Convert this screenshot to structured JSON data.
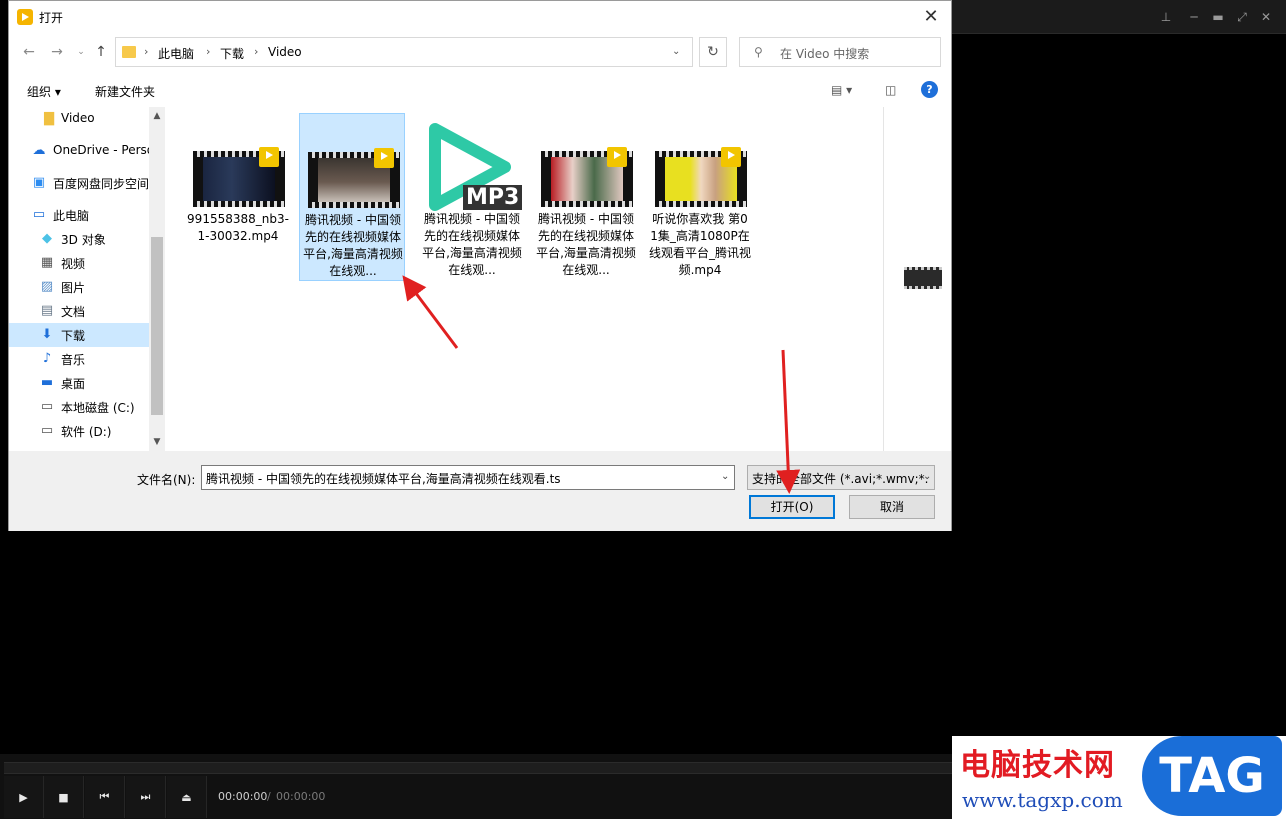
{
  "dialog": {
    "title": "打开",
    "breadcrumb": [
      "此电脑",
      "下载",
      "Video"
    ],
    "search_placeholder": "在 Video 中搜索",
    "toolbar": {
      "organize": "组织",
      "new_folder": "新建文件夹"
    },
    "nav_items": [
      {
        "label": "Video",
        "icon": "folder-icon"
      },
      {
        "label": "OneDrive - Perso",
        "icon": "cloud-icon"
      },
      {
        "label": "百度网盘同步空间",
        "icon": "baidu-icon"
      },
      {
        "label": "此电脑",
        "icon": "computer-icon"
      },
      {
        "label": "3D 对象",
        "icon": "cube-icon"
      },
      {
        "label": "视频",
        "icon": "video-icon"
      },
      {
        "label": "图片",
        "icon": "picture-icon"
      },
      {
        "label": "文档",
        "icon": "document-icon"
      },
      {
        "label": "下载",
        "icon": "download-icon",
        "selected": true
      },
      {
        "label": "音乐",
        "icon": "music-icon"
      },
      {
        "label": "桌面",
        "icon": "desktop-icon"
      },
      {
        "label": "本地磁盘 (C:)",
        "icon": "drive-icon"
      },
      {
        "label": "软件 (D:)",
        "icon": "drive-icon"
      }
    ],
    "files": [
      {
        "name": "991558388_nb3-1-30032.mp4",
        "type": "video"
      },
      {
        "name": "腾讯视频 - 中国领先的在线视频媒体平台,海量高清视频在线观...",
        "type": "video",
        "selected": true
      },
      {
        "name": "腾讯视频 - 中国领先的在线视频媒体平台,海量高清视频在线观...",
        "type": "mp3",
        "badge": "MP3"
      },
      {
        "name": "腾讯视频 - 中国领先的在线视频媒体平台,海量高清视频在线观...",
        "type": "video"
      },
      {
        "name": "听说你喜欢我 第01集_高清1080P在线观看平台_腾讯视频.mp4",
        "type": "video"
      }
    ],
    "filename_label": "文件名(N):",
    "filename_value": "腾讯视频 - 中国领先的在线视频媒体平台,海量高清视频在线观看.ts",
    "filter_value": "支持的全部文件 (*.avi;*.wmv;*.",
    "open_label": "打开(O)",
    "cancel_label": "取消"
  },
  "player": {
    "time_current": "00:00:00",
    "time_sep": "/",
    "time_total": "00:00:00"
  },
  "watermark": {
    "title": "电脑技术网",
    "url": "www.tagxp.com",
    "tag": "TAG"
  },
  "colors": {
    "accent": "#0078d7",
    "selection": "#cce8ff",
    "arrow": "#e02020"
  }
}
